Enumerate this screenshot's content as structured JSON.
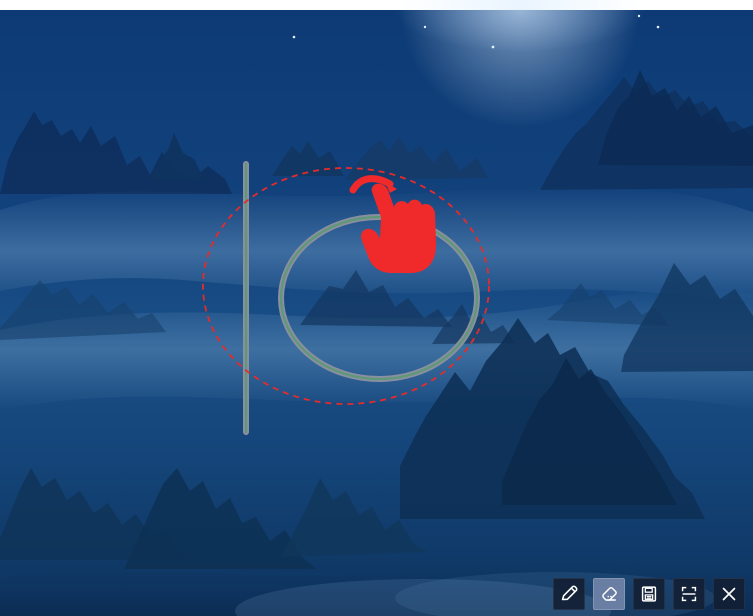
{
  "canvas": {
    "background_theme": "misty-night-forest"
  },
  "toolbar": {
    "buttons": [
      {
        "name": "pen",
        "icon": "pencil-icon",
        "active": false
      },
      {
        "name": "eraser",
        "icon": "eraser-icon",
        "active": true
      },
      {
        "name": "save",
        "icon": "save-icon",
        "active": false
      },
      {
        "name": "crop",
        "icon": "crop-icon",
        "active": false
      },
      {
        "name": "close",
        "icon": "close-icon",
        "active": false
      }
    ]
  },
  "annotations": {
    "stroke_color": "#5e9876",
    "stroke_outline_color": "#8a8fa1",
    "selection_color": "#e62b2b",
    "cursor_color": "#f02a2a"
  }
}
